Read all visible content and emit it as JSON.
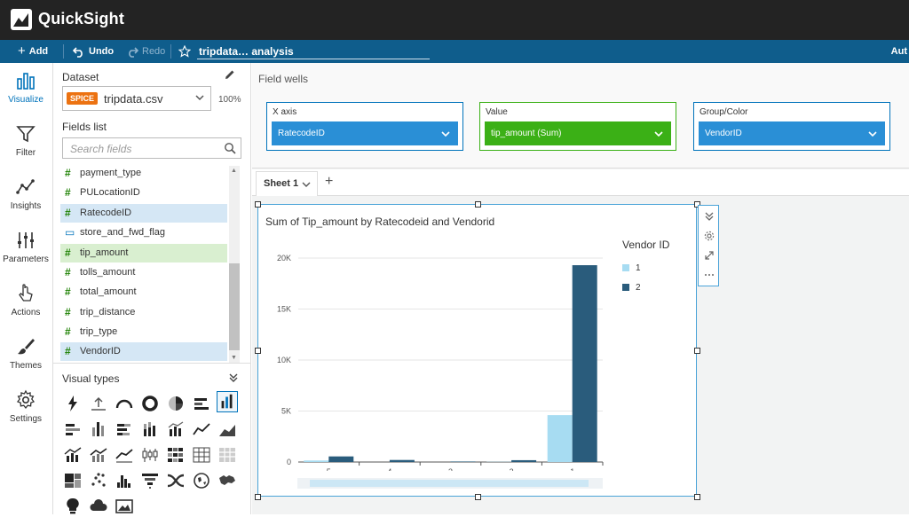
{
  "app": {
    "title": "QuickSight"
  },
  "toolbar": {
    "add_label": "Add",
    "undo_label": "Undo",
    "redo_label": "Redo",
    "analysis_name": "tripdata… analysis",
    "right_text": "Aut"
  },
  "rail": {
    "items": [
      {
        "label": "Visualize",
        "icon": "bar-chart-icon"
      },
      {
        "label": "Filter",
        "icon": "funnel-icon"
      },
      {
        "label": "Insights",
        "icon": "insights-icon"
      },
      {
        "label": "Parameters",
        "icon": "sliders-icon"
      },
      {
        "label": "Actions",
        "icon": "pointer-icon"
      },
      {
        "label": "Themes",
        "icon": "brush-icon"
      },
      {
        "label": "Settings",
        "icon": "gear-icon"
      }
    ]
  },
  "panel": {
    "dataset_heading": "Dataset",
    "spice_badge": "SPICE",
    "dataset_name": "tripdata.csv",
    "spice_percent": "100%",
    "fields_heading": "Fields list",
    "search_placeholder": "Search fields",
    "fields": [
      {
        "name": "payment_type",
        "type": "#"
      },
      {
        "name": "PULocationID",
        "type": "#"
      },
      {
        "name": "RatecodeID",
        "type": "#"
      },
      {
        "name": "store_and_fwd_flag",
        "type": "▭"
      },
      {
        "name": "tip_amount",
        "type": "#"
      },
      {
        "name": "tolls_amount",
        "type": "#"
      },
      {
        "name": "total_amount",
        "type": "#"
      },
      {
        "name": "trip_distance",
        "type": "#"
      },
      {
        "name": "trip_type",
        "type": "#"
      },
      {
        "name": "VendorID",
        "type": "#"
      }
    ],
    "visual_types_heading": "Visual types"
  },
  "field_wells": {
    "title": "Field wells",
    "wells": [
      {
        "label": "X axis",
        "value": "RatecodeID"
      },
      {
        "label": "Value",
        "value": "tip_amount (Sum)"
      },
      {
        "label": "Group/Color",
        "value": "VendorID"
      }
    ]
  },
  "sheet": {
    "tab_label": "Sheet 1"
  },
  "colors": {
    "accent": "#0073bb",
    "series_1": "#a7dcf2",
    "series_2": "#2a5c7c",
    "toolbar": "#0f5d8c"
  },
  "chart_data": {
    "type": "bar",
    "title": "Sum of Tip_amount by Ratecodeid and Vendorid",
    "xlabel": "",
    "ylabel": "",
    "categories": [
      "5",
      "4",
      "3",
      "2",
      "1"
    ],
    "legend_title": "Vendor ID",
    "legend_position": "right",
    "y_ticks": [
      "0",
      "5K",
      "10K",
      "15K",
      "20K"
    ],
    "ylim": [
      0,
      20000
    ],
    "grid": true,
    "series": [
      {
        "name": "1",
        "values": [
          150,
          0,
          0,
          20,
          4600
        ]
      },
      {
        "name": "2",
        "values": [
          550,
          200,
          50,
          180,
          19300
        ]
      }
    ]
  }
}
